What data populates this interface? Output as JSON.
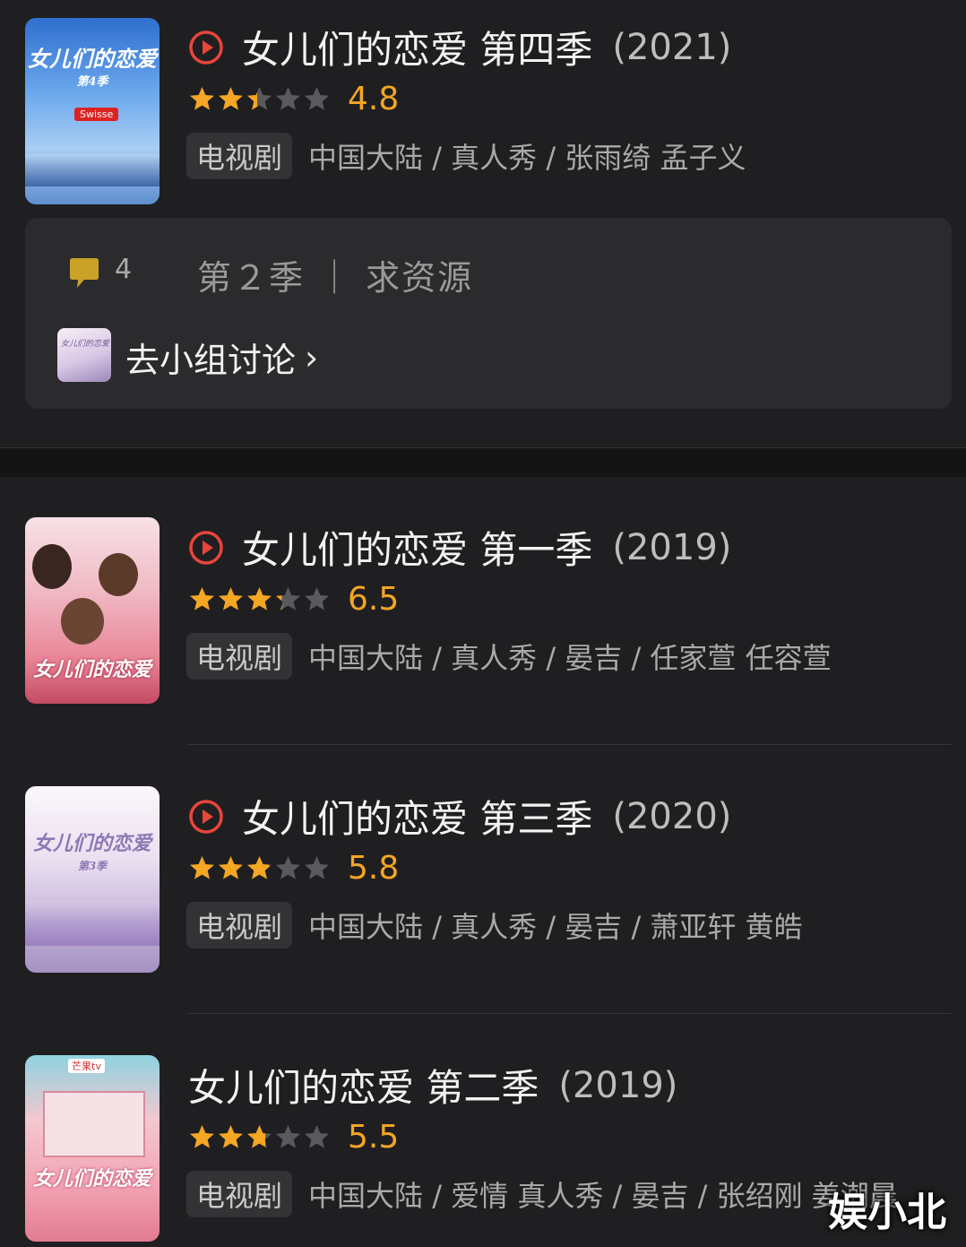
{
  "items": [
    {
      "title": "女儿们的恋爱 第四季",
      "year": "(2021)",
      "score": "4.8",
      "stars": 2.4,
      "tag": "电视剧",
      "meta": "中国大陆 / 真人秀 / 张雨绮 孟子义",
      "has_play": true
    },
    {
      "title": "女儿们的恋爱 第一季",
      "year": "(2019)",
      "score": "6.5",
      "stars": 3.25,
      "tag": "电视剧",
      "meta": "中国大陆 / 真人秀 / 晏吉 / 任家萱 任容萱",
      "has_play": true
    },
    {
      "title": "女儿们的恋爱 第三季",
      "year": "(2020)",
      "score": "5.8",
      "stars": 2.9,
      "tag": "电视剧",
      "meta": "中国大陆 / 真人秀 / 晏吉 / 萧亚轩 黄皓",
      "has_play": true
    },
    {
      "title": "女儿们的恋爱 第二季",
      "year": "(2019)",
      "score": "5.5",
      "stars": 2.75,
      "tag": "电视剧",
      "meta": "中国大陆 / 爱情 真人秀 / 晏吉 / 张绍刚 姜潮晨",
      "has_play": false
    }
  ],
  "group": {
    "comment_count": "4",
    "topic": "第２季 ｜ 求资源",
    "link_label": "去小组讨论",
    "chevron": "›"
  },
  "posters": {
    "p1_title": "女儿们的恋爱",
    "p1_sub": "第4季",
    "p1_brand": "Swisse",
    "p2_title": "女儿们的恋爱",
    "p3_title": "女儿们的恋爱",
    "p3_sub": "第3季",
    "p4_logo": "芒果tv",
    "p4_title": "女儿们的恋爱"
  },
  "watermark": "娱小北",
  "colors": {
    "background": "#1f1f21",
    "star_on": "#f5a623",
    "star_off": "#5a5a5c",
    "play_red": "#e8453c",
    "score": "#f5a623"
  },
  "icons": [
    "play-icon",
    "star-icon",
    "comment-icon",
    "chevron-right-icon"
  ]
}
